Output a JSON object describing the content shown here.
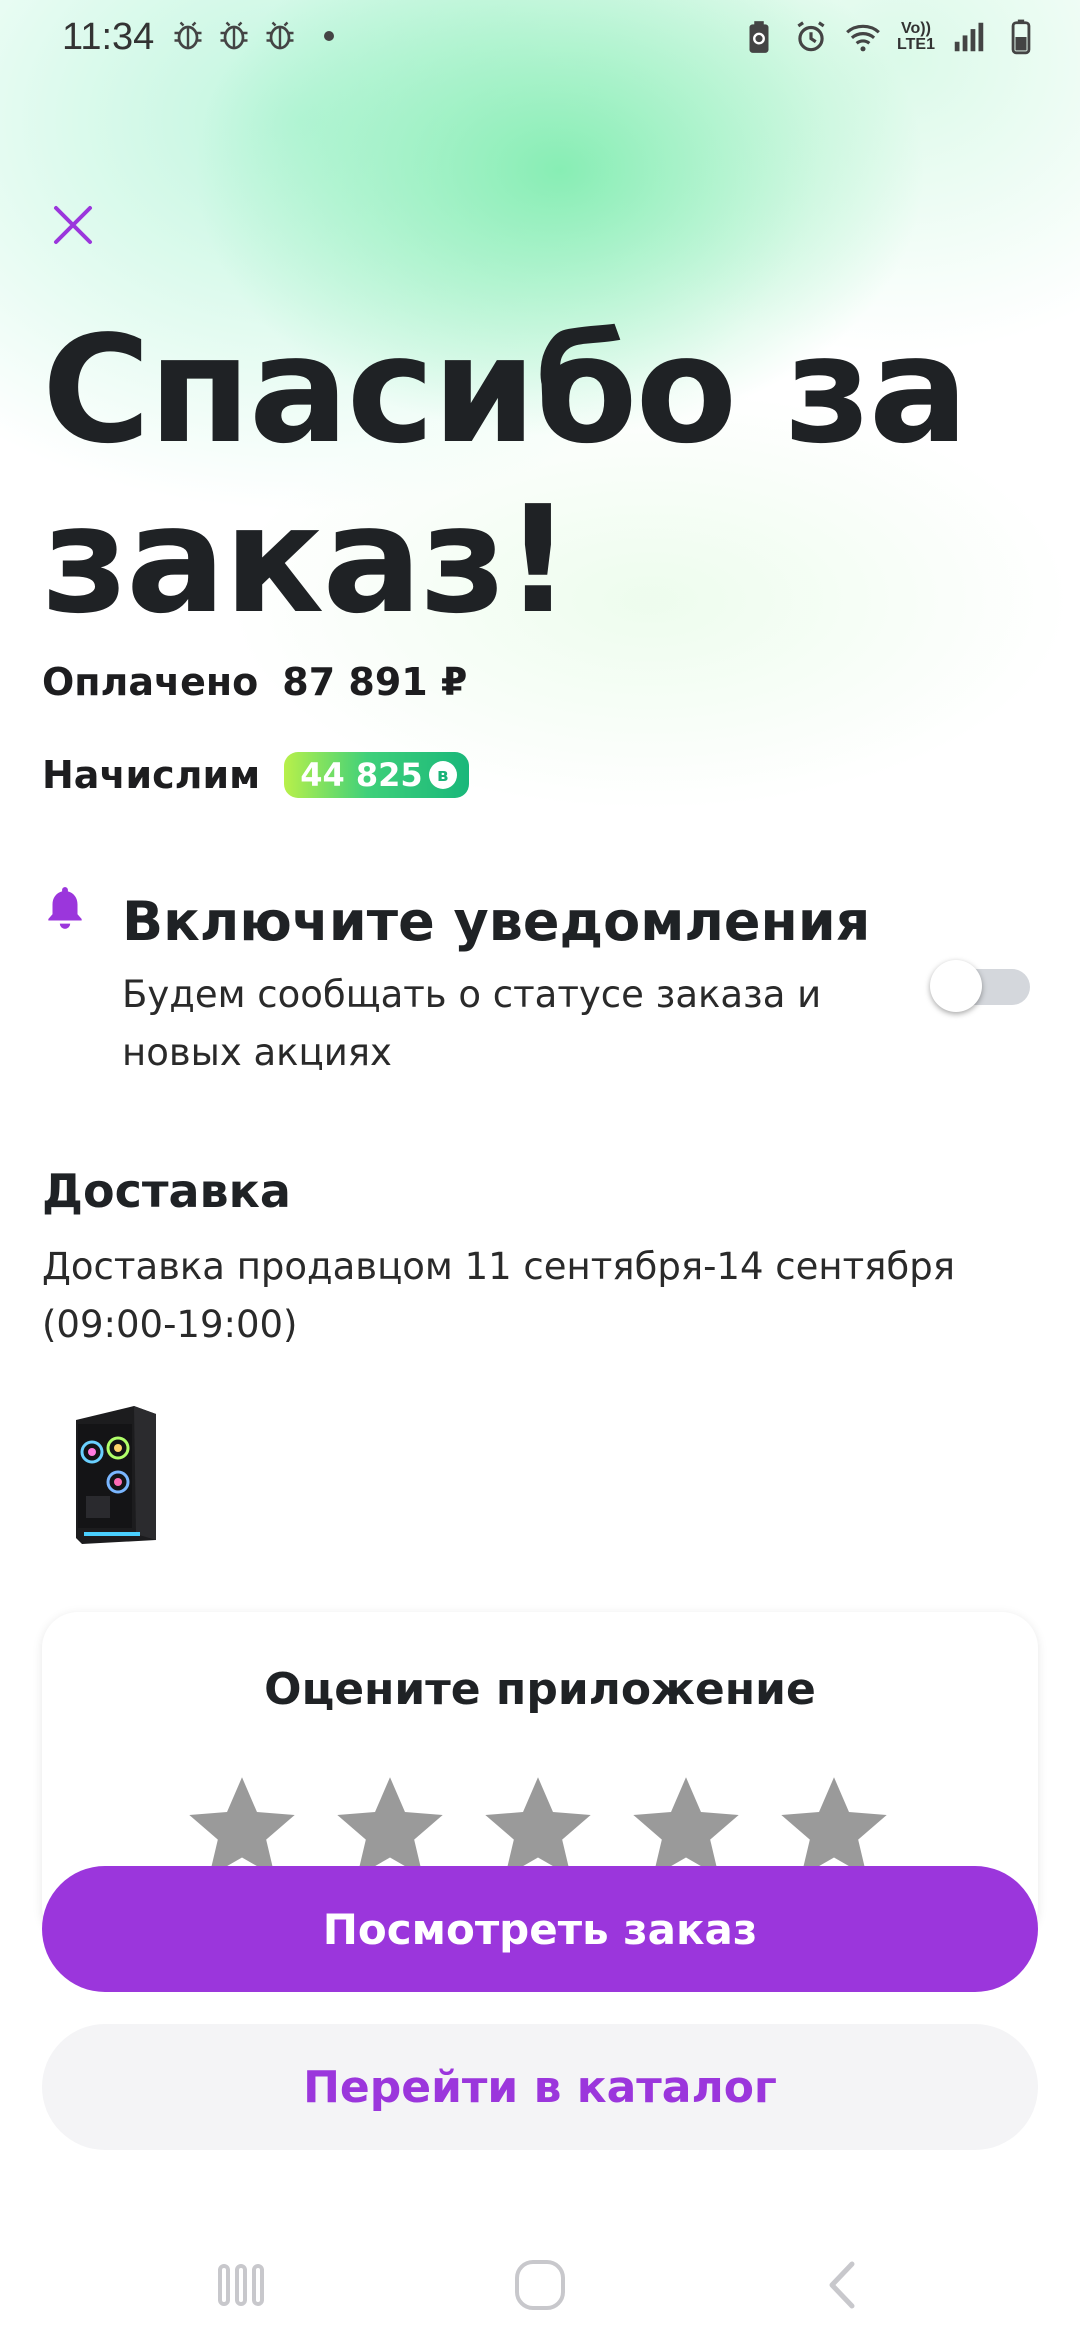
{
  "status_bar": {
    "time": "11:34",
    "network_label": "Vo)) LTE1",
    "left_icons": [
      "bug-icon",
      "bug-icon",
      "bug-icon"
    ],
    "right_icons": [
      "battery-saver-icon",
      "alarm-icon",
      "wifi-icon",
      "signal-icon",
      "battery-icon"
    ]
  },
  "header": {
    "close_icon": "close-icon",
    "title": "Спасибо за заказ!"
  },
  "payment": {
    "paid_label": "Оплачено",
    "paid_amount": "87 891 ₽",
    "bonus_label": "Начислим",
    "bonus_amount": "44 825",
    "bonus_icon": "bonus-coin-icon"
  },
  "notifications": {
    "title": "Включите уведомления",
    "description": "Будем сообщать о статусе заказа и новых акциях",
    "toggle_on": false,
    "icon": "bell-icon"
  },
  "delivery": {
    "title": "Доставка",
    "text": "Доставка продавцом 11 сентября-14 сентября (09:00-19:00)",
    "product_image": "pc-case-image"
  },
  "rating": {
    "title": "Оцените приложение",
    "stars": 5,
    "rating_value": 0
  },
  "actions": {
    "view_order": "Посмотреть заказ",
    "go_catalog": "Перейти в каталог"
  },
  "colors": {
    "accent": "#9b36dc",
    "secondary_bg": "#f4f4f6",
    "star_empty": "#9a9a9a",
    "bonus_gradient_start": "#b8f04a",
    "bonus_gradient_end": "#19b77a"
  }
}
